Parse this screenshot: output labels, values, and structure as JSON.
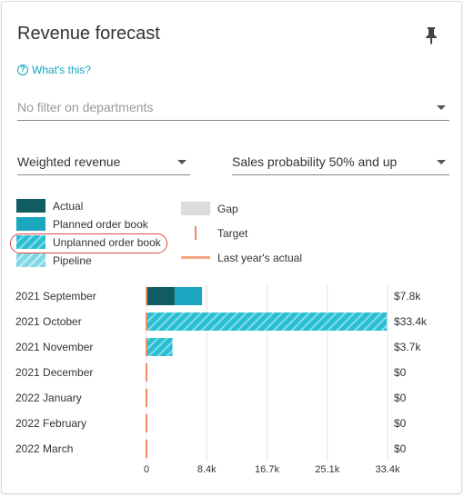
{
  "header": {
    "title": "Revenue forecast",
    "pin_icon": "pin-icon",
    "whats_this": "What's this?",
    "help_icon": "question-circle-icon"
  },
  "filters": {
    "departments_placeholder": "No filter on departments",
    "revenue_type": "Weighted revenue",
    "probability": "Sales probability 50% and up"
  },
  "legend": {
    "actual": "Actual",
    "planned": "Planned order book",
    "unplanned": "Unplanned order book",
    "pipeline": "Pipeline",
    "gap": "Gap",
    "target": "Target",
    "last_year": "Last year's actual"
  },
  "colors": {
    "actual": "#0f5d63",
    "planned": "#1aa7bf",
    "unplanned": "#28bfd3",
    "pipeline": "#7ed8e6",
    "target": "#f08c64",
    "last_year": "#f4a582",
    "accent": "#11a6c0",
    "highlight": "#e04848"
  },
  "chart_data": {
    "type": "bar",
    "orientation": "horizontal",
    "stacked": true,
    "categories": [
      "2021 September",
      "2021 October",
      "2021 November",
      "2021 December",
      "2022 January",
      "2022 February",
      "2022 March"
    ],
    "series": [
      {
        "name": "Actual",
        "values": [
          3.9,
          0,
          0,
          0,
          0,
          0,
          0
        ]
      },
      {
        "name": "Planned order book",
        "values": [
          3.8,
          0,
          0,
          0,
          0,
          0,
          0
        ]
      },
      {
        "name": "Unplanned order book",
        "values": [
          0,
          33.3,
          3.6,
          0,
          0,
          0,
          0
        ]
      }
    ],
    "totals": [
      "$7.8k",
      "$33.4k",
      "$3.7k",
      "$0",
      "$0",
      "$0",
      "$0"
    ],
    "target": [
      0,
      0,
      0,
      0,
      0,
      0,
      0
    ],
    "x_ticks": [
      "0",
      "8.4k",
      "16.7k",
      "25.1k",
      "33.4k"
    ],
    "xlim": [
      0,
      33.4
    ],
    "grid": true
  }
}
